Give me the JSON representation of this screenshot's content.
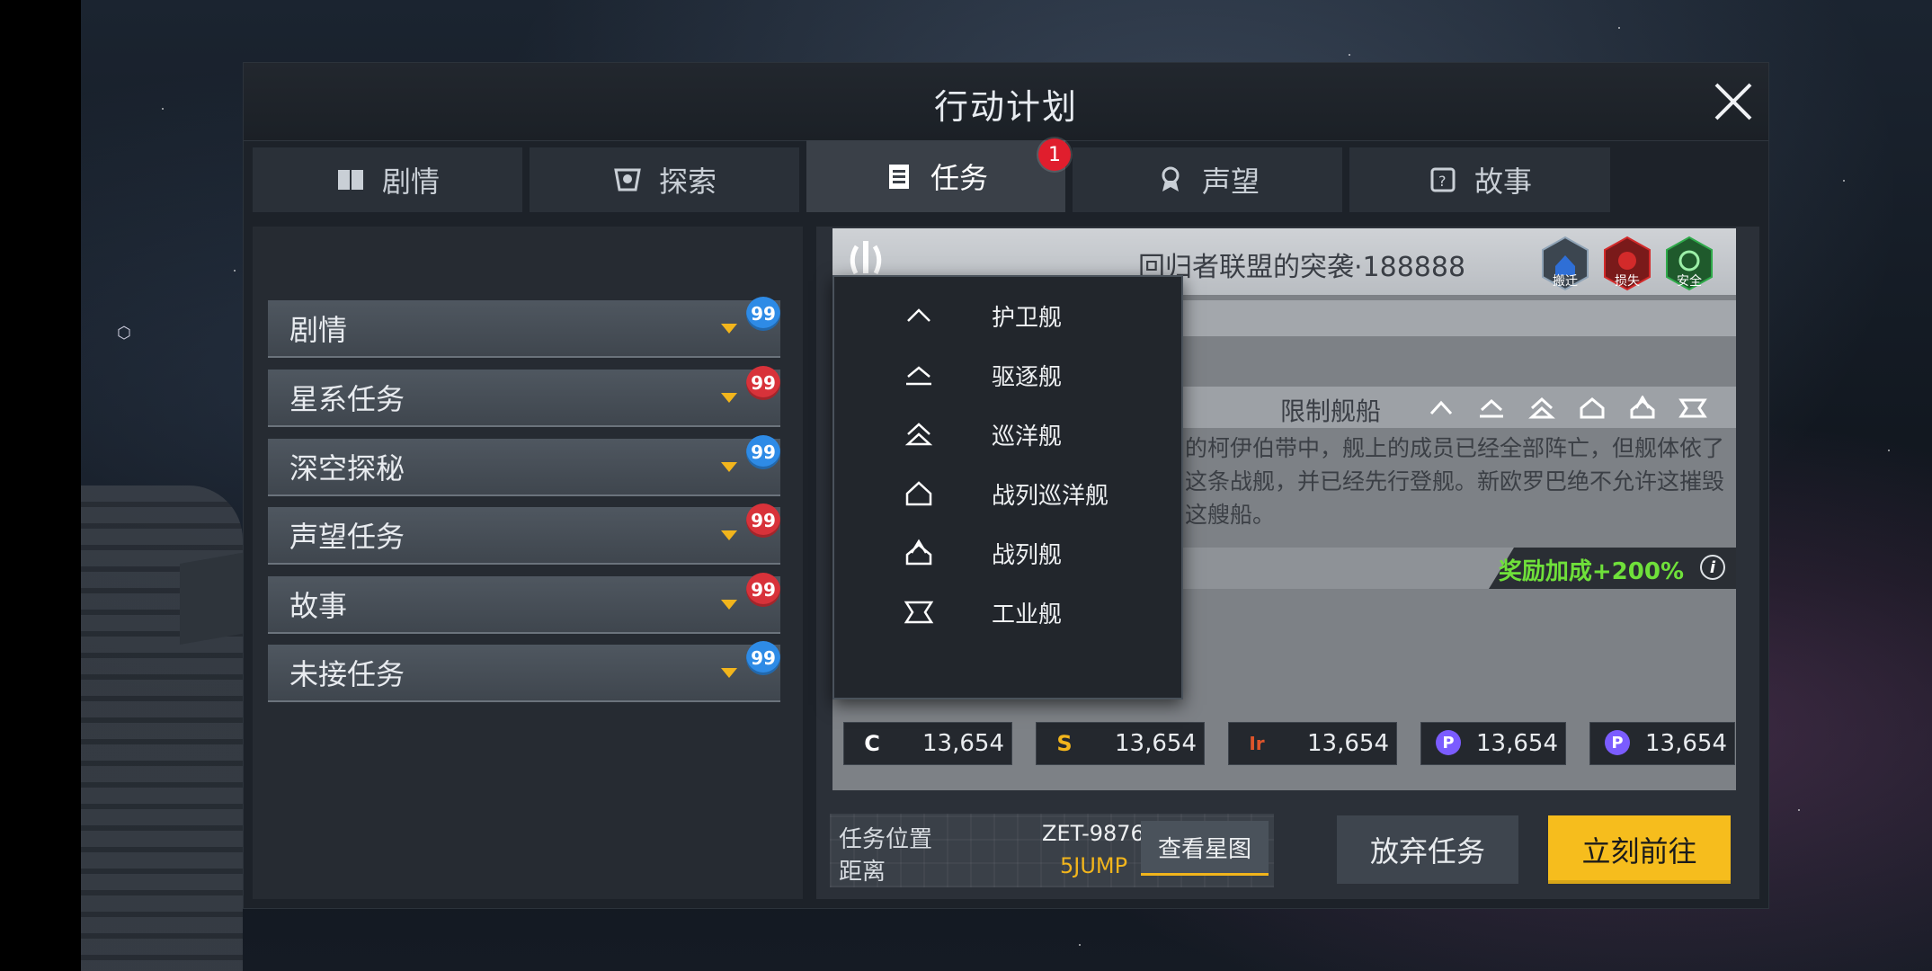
{
  "dialog": {
    "title": "行动计划"
  },
  "tabs": [
    {
      "label": "剧情",
      "icon": "book-icon"
    },
    {
      "label": "探索",
      "icon": "explore-icon"
    },
    {
      "label": "任务",
      "icon": "task-clipboard-icon",
      "badge": "1"
    },
    {
      "label": "声望",
      "icon": "reputation-medal-icon"
    },
    {
      "label": "故事",
      "icon": "story-icon"
    }
  ],
  "categories": [
    {
      "label": "剧情",
      "count": "99",
      "count_color": "#2e8be6"
    },
    {
      "label": "星系任务",
      "count": "99",
      "count_color": "#d8323a"
    },
    {
      "label": "深空探秘",
      "count": "99",
      "count_color": "#2e8be6"
    },
    {
      "label": "声望任务",
      "count": "99",
      "count_color": "#d8323a"
    },
    {
      "label": "故事",
      "count": "99",
      "count_color": "#d8323a"
    },
    {
      "label": "未接任务",
      "count": "99",
      "count_color": "#2e8be6"
    }
  ],
  "mission": {
    "title": "回归者联盟的突袭·188888",
    "status": [
      {
        "label": "搬迁",
        "color": "#2f6fd6"
      },
      {
        "label": "损失",
        "color": "#d32a2a"
      },
      {
        "label": "安全",
        "color": "#2faa4a"
      }
    ],
    "restrict_label": "限制舰船",
    "description": "的柯伊伯带中，舰上的成员已经全部阵亡，但舰体依了这条战舰，并已经先行登舰。新欧罗巴绝不允许这摧毁这艘船。",
    "reward": "奖励加成+200%",
    "resources": [
      {
        "icon": "C",
        "color": "#ffffff",
        "value": "13,654"
      },
      {
        "icon": "S",
        "color": "#f2b51c",
        "value": "13,654"
      },
      {
        "icon": "Ir",
        "color": "#e0552b",
        "value": "13,654"
      },
      {
        "icon": "P",
        "color": "#7b5cff",
        "value": "13,654"
      },
      {
        "icon": "P",
        "color": "#7b5cff",
        "value": "13,654"
      }
    ]
  },
  "ship_types": [
    {
      "label": "护卫舰",
      "icon": "frigate-icon"
    },
    {
      "label": "驱逐舰",
      "icon": "destroyer-icon"
    },
    {
      "label": "巡洋舰",
      "icon": "cruiser-icon"
    },
    {
      "label": "战列巡洋舰",
      "icon": "battlecruiser-icon"
    },
    {
      "label": "战列舰",
      "icon": "battleship-icon"
    },
    {
      "label": "工业舰",
      "icon": "industrial-icon"
    }
  ],
  "location": {
    "label": "任务位置",
    "value": "ZET-9876",
    "distance_label": "距离",
    "distance_value": "5JUMP",
    "map_button": "查看星图"
  },
  "actions": {
    "abandon": "放弃任务",
    "go": "立刻前往"
  }
}
